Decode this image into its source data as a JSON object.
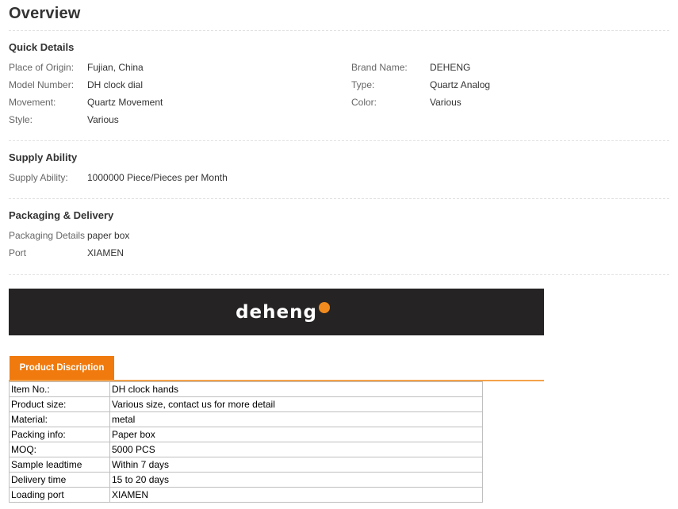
{
  "title": "Overview",
  "quick_details": {
    "heading": "Quick Details",
    "left": [
      {
        "label": "Place of Origin:",
        "value": "Fujian, China"
      },
      {
        "label": "Model Number:",
        "value": "DH clock dial"
      },
      {
        "label": "Movement:",
        "value": "Quartz Movement"
      },
      {
        "label": "Style:",
        "value": "Various"
      }
    ],
    "right": [
      {
        "label": "Brand Name:",
        "value": "DEHENG"
      },
      {
        "label": "Type:",
        "value": "Quartz Analog"
      },
      {
        "label": "Color:",
        "value": "Various"
      }
    ]
  },
  "supply": {
    "heading": "Supply Ability",
    "rows": [
      {
        "label": "Supply Ability:",
        "value": "1000000 Piece/Pieces per Month"
      }
    ]
  },
  "packaging": {
    "heading": "Packaging & Delivery",
    "rows": [
      {
        "label": "Packaging Details",
        "value": "paper box"
      },
      {
        "label": "Port",
        "value": "XIAMEN"
      }
    ]
  },
  "banner": {
    "logo_text": "deheng",
    "background": "#252323",
    "accent": "#f08a1e"
  },
  "tab": {
    "label": "Product Discription",
    "color": "#f07a0d"
  },
  "spec_table": [
    [
      "Item No.:",
      "DH clock hands"
    ],
    [
      "Product size:",
      "Various size, contact us for more detail"
    ],
    [
      "Material:",
      "metal"
    ],
    [
      "Packing info:",
      "Paper box"
    ],
    [
      "MOQ:",
      "5000 PCS"
    ],
    [
      "Sample leadtime",
      "Within 7 days"
    ],
    [
      "Delivery time",
      "15 to 20 days"
    ],
    [
      "Loading port",
      "XIAMEN"
    ]
  ]
}
